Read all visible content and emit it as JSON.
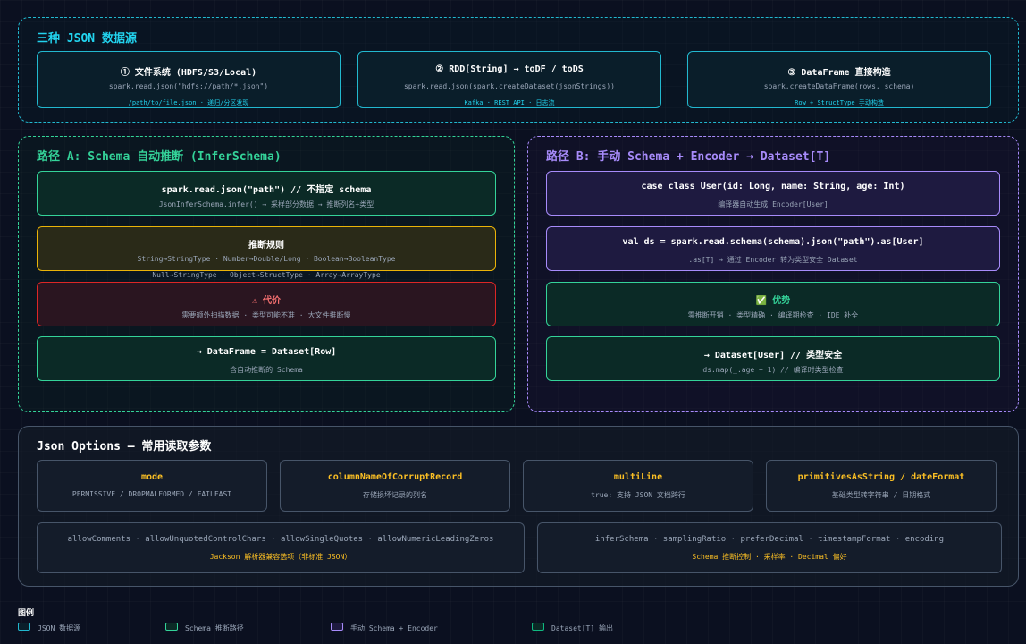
{
  "sources": {
    "title": "三种 JSON 数据源",
    "cards": [
      {
        "title": "① 文件系统 (HDFS/S3/Local)",
        "code": "spark.read.json(\"hdfs://path/*.json\")",
        "note": "/path/to/file.json · 递归/分区发现"
      },
      {
        "title": "② RDD[String] → toDF / toDS",
        "code": "spark.read.json(spark.createDataset(jsonStrings))",
        "note": "Kafka · REST API · 日志流"
      },
      {
        "title": "③ DataFrame 直接构造",
        "code": "spark.createDataFrame(rows, schema)",
        "note": "Row + StructType 手动构造"
      }
    ]
  },
  "path_a": {
    "title": "路径 A: Schema 自动推断 (InferSchema)",
    "cards": [
      {
        "title": "spark.read.json(\"path\") // 不指定 schema",
        "line1": "JsonInferSchema.infer() → 采样部分数据 → 推断列名+类型"
      },
      {
        "title": "推断规则",
        "line1": "String→StringType · Number→Double/Long · Boolean→BooleanType",
        "line2": "Null→StringType · Object→StructType · Array→ArrayType"
      },
      {
        "icon": "warning-icon",
        "title": "⚠ 代价",
        "line1": "需要额外扫描数据 · 类型可能不准 · 大文件推断慢"
      },
      {
        "title": "→ DataFrame = Dataset[Row]",
        "line1": "含自动推断的 Schema"
      }
    ]
  },
  "path_b": {
    "title": "路径 B: 手动 Schema + Encoder → Dataset[T]",
    "cards": [
      {
        "title": "case class User(id: Long, name: String, age: Int)",
        "line1": "编译器自动生成 Encoder[User]"
      },
      {
        "title": "val ds = spark.read.schema(schema).json(\"path\").as[User]",
        "line1": ".as[T] → 通过 Encoder 转为类型安全 Dataset"
      },
      {
        "icon": "check-icon",
        "title": "✅ 优势",
        "line1": "零推断开销 · 类型精确 · 编译期检查 · IDE 补全"
      },
      {
        "title": "→ Dataset[User] // 类型安全",
        "line1": "ds.map(_.age + 1) // 编译时类型检查"
      }
    ]
  },
  "options": {
    "title": "Json Options — 常用读取参数",
    "cards": [
      {
        "title": "mode",
        "line1": "PERMISSIVE / DROPMALFORMED / FAILFAST"
      },
      {
        "title": "columnNameOfCorruptRecord",
        "line1": "存储损坏记录的列名"
      },
      {
        "title": "multiLine",
        "line1": "true: 支持 JSON 文档跨行"
      },
      {
        "title": "primitivesAsString / dateFormat",
        "line1": "基础类型转字符串 / 日期格式"
      }
    ],
    "wide": [
      {
        "line1": "allowComments · allowUnquotedControlChars · allowSingleQuotes · allowNumericLeadingZeros",
        "line2": "Jackson 解析器兼容选项（非标准 JSON）"
      },
      {
        "line1": "inferSchema · samplingRatio · preferDecimal · timestampFormat · encoding",
        "line2": "Schema 推断控制 · 采样率 · Decimal 偏好"
      }
    ]
  },
  "legend": {
    "title": "图例",
    "items": [
      {
        "label": "JSON 数据源",
        "color": "#22b8cf"
      },
      {
        "label": "Schema 推断路径",
        "color": "#34d399"
      },
      {
        "label": "手动 Schema + Encoder",
        "color": "#a78bfa"
      },
      {
        "label": "Dataset[T] 输出",
        "color": "#10b981"
      }
    ]
  }
}
